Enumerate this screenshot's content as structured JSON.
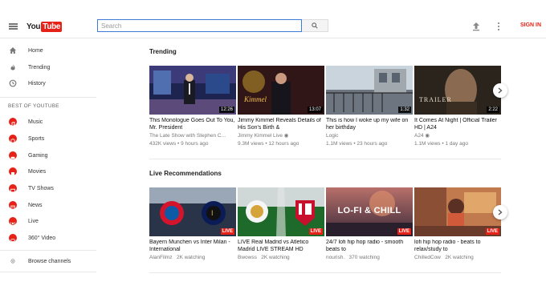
{
  "header": {
    "logo_you": "You",
    "logo_tube": "Tube",
    "search_placeholder": "Search",
    "signin_label": "SIGN IN"
  },
  "sidebar": {
    "top_items": [
      {
        "label": "Home",
        "icon": "home-icon"
      },
      {
        "label": "Trending",
        "icon": "flame-icon"
      },
      {
        "label": "History",
        "icon": "history-icon"
      }
    ],
    "section_heading": "BEST OF YOUTUBE",
    "best_items": [
      {
        "label": "Music",
        "icon": "music-icon"
      },
      {
        "label": "Sports",
        "icon": "sports-icon"
      },
      {
        "label": "Gaming",
        "icon": "gaming-icon"
      },
      {
        "label": "Movies",
        "icon": "movies-icon"
      },
      {
        "label": "TV Shows",
        "icon": "tv-icon"
      },
      {
        "label": "News",
        "icon": "news-icon"
      },
      {
        "label": "Live",
        "icon": "live-icon"
      },
      {
        "label": "360° Video",
        "icon": "360-icon"
      }
    ],
    "browse_label": "Browse channels"
  },
  "trending": {
    "title": "Trending",
    "videos": [
      {
        "title": "This Monologue Goes Out To You, Mr. President",
        "channel": "The Late Show with Stephen C...",
        "meta": "432K views • 9 hours ago",
        "duration": "12:26"
      },
      {
        "title": "Jimmy Kimmel Reveals Details of His Son's Birth &",
        "channel": "Jimmy Kimmel Live",
        "meta": "9.3M views • 12 hours ago",
        "duration": "13:07"
      },
      {
        "title": "This is how I woke up my wife on her birthday",
        "channel": "Logic",
        "meta": "1.1M views • 23 hours ago",
        "duration": "1:32"
      },
      {
        "title": "It Comes At Night | Official Trailer HD | A24",
        "channel": "A24",
        "meta": "1.1M views • 1 day ago",
        "duration": "2:22"
      }
    ]
  },
  "live": {
    "title": "Live Recommendations",
    "badge": "LIVE",
    "videos": [
      {
        "title": "Bayern Munchen vs Inter Milan - International",
        "channel": "AlanFilmz",
        "meta": "2K watching"
      },
      {
        "title": "LIVE Real Madrid vs Atletico Madrid LIVE STREAM HD",
        "channel": "Bwowss",
        "meta": "2K watching"
      },
      {
        "title": "24/7 lofi hip hop radio - smooth beats to",
        "channel": "nourish.",
        "meta": "370 watching",
        "overlay": "LO-FI & CHILL"
      },
      {
        "title": "lofi hip hop radio - beats to relax/study to",
        "channel": "ChilledCow",
        "meta": "2K watching"
      }
    ]
  },
  "colors": {
    "brand_red": "#e62117",
    "search_border": "#3d7bd6"
  }
}
